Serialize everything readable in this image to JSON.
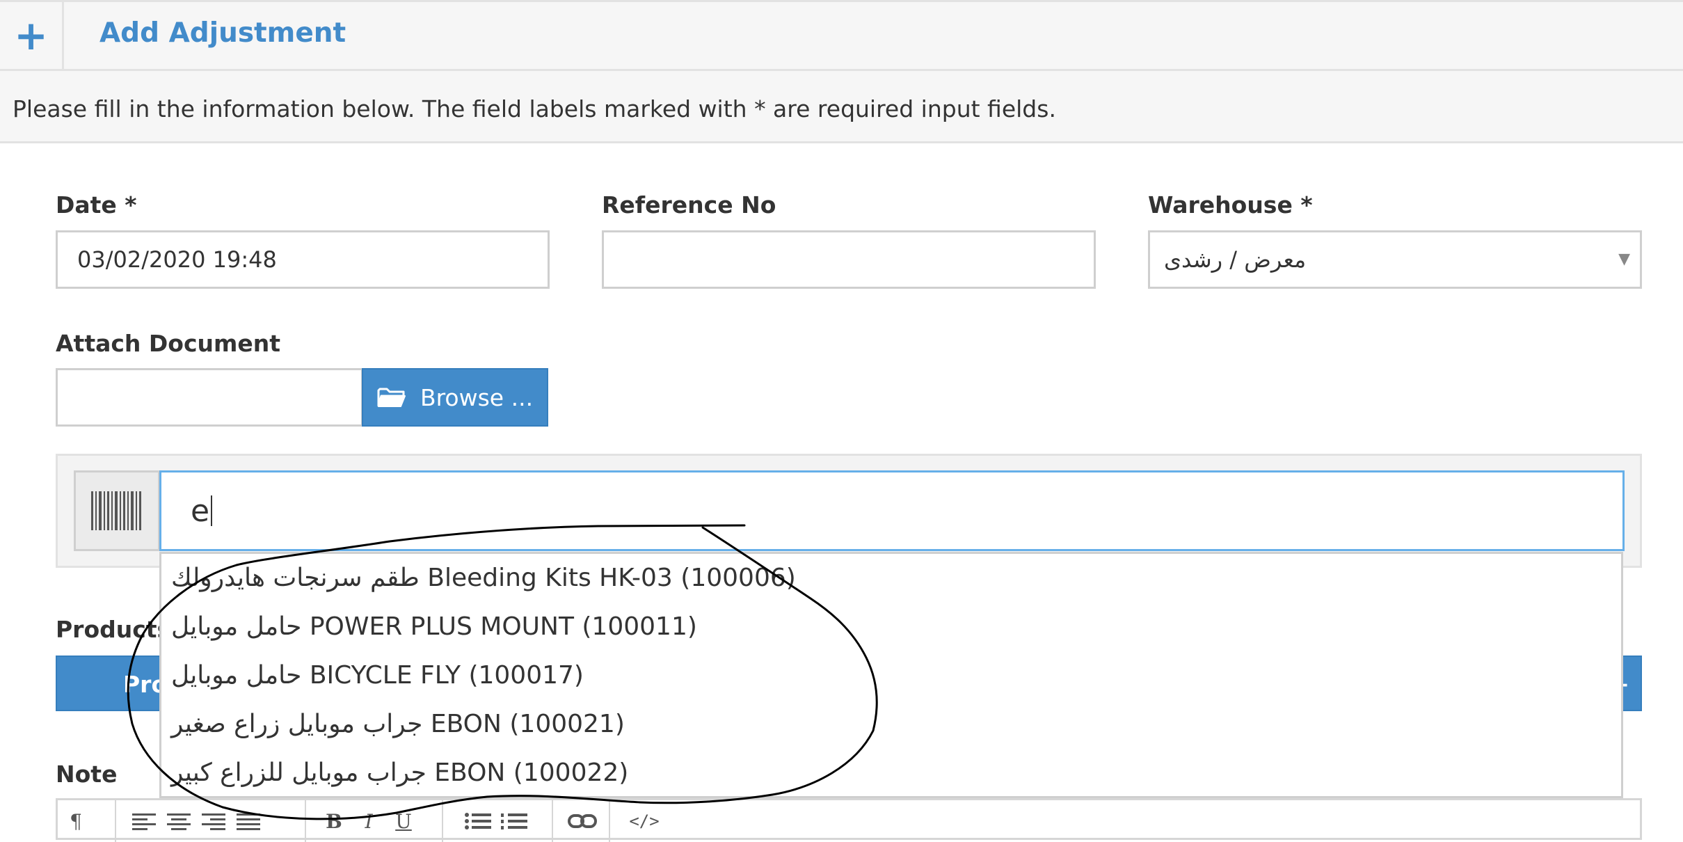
{
  "header": {
    "add_icon": "+",
    "title": "Add Adjustment"
  },
  "info": {
    "text": "Please fill in the information below. The field labels marked with * are required input fields."
  },
  "form": {
    "date": {
      "label": "Date *",
      "value": "03/02/2020 19:48"
    },
    "reference": {
      "label": "Reference No",
      "value": ""
    },
    "warehouse": {
      "label": "Warehouse *",
      "value": "معرض / رشدى",
      "arrow": "▼"
    },
    "attach": {
      "label": "Attach Document",
      "value": "",
      "button": "Browse ...",
      "icon": "folder-open-icon"
    }
  },
  "search": {
    "icon": "barcode-icon",
    "value": "e"
  },
  "dropdown": {
    "items": [
      "طقم سرنجات هايدرولك Bleeding Kits HK-03 (100006)",
      "حامل موبايل POWER PLUS MOUNT (100011)",
      "حامل موبايل BICYCLE FLY (100017)",
      "جراب موبايل زراع صغير EBON (100021)",
      "جراب موبايل للزراع كبير EBON (100022)"
    ]
  },
  "products": {
    "label": "Products",
    "header_partial": "Pro",
    "header_right": "+"
  },
  "note": {
    "label": "Note"
  },
  "toolbar": {
    "paragraph": "¶",
    "bold": "B",
    "italic": "I",
    "underline": "U",
    "code": "</>"
  },
  "colors": {
    "accent": "#428bca",
    "focus": "#66afe9",
    "panel": "#f6f6f6"
  }
}
